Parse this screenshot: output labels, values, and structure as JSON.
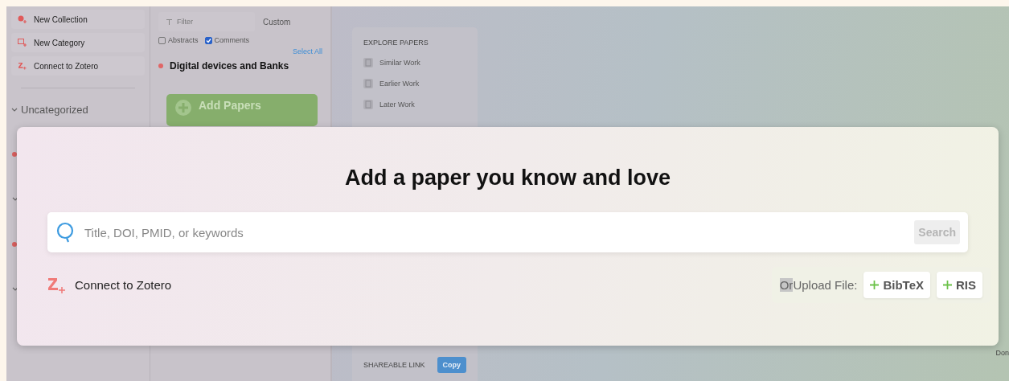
{
  "sidebar": {
    "actions": [
      {
        "label": "New Collection",
        "kind": "collection"
      },
      {
        "label": "New Category",
        "kind": "category"
      },
      {
        "label": "Connect to Zotero",
        "kind": "zotero"
      }
    ],
    "group": {
      "label": "Uncategorized",
      "expanded": true
    }
  },
  "collection": {
    "filter": {
      "placeholder": "Filter"
    },
    "sort": "Custom",
    "options": [
      {
        "label": "Abstracts",
        "checked": false
      },
      {
        "label": "Comments",
        "checked": true
      }
    ],
    "select_all": "Select All",
    "title": "Digital devices and Banks",
    "add_button": "Add Papers"
  },
  "explore": {
    "heading": "EXPLORE PAPERS",
    "items": [
      "Similar Work",
      "Earlier Work",
      "Later Work"
    ],
    "share_label": "SHAREABLE LINK",
    "copy_button": "Copy"
  },
  "corner_text": "Don",
  "modal": {
    "title": "Add a paper you know and love",
    "search": {
      "placeholder": "Title, DOI, PMID, or keywords",
      "button": "Search",
      "disabled": true
    },
    "zotero": "Connect to Zotero",
    "upload": {
      "prefix": "Or",
      "prefix_selected": true,
      "label": "Upload File:",
      "buttons": [
        "BibTeX",
        "RIS"
      ]
    }
  }
}
